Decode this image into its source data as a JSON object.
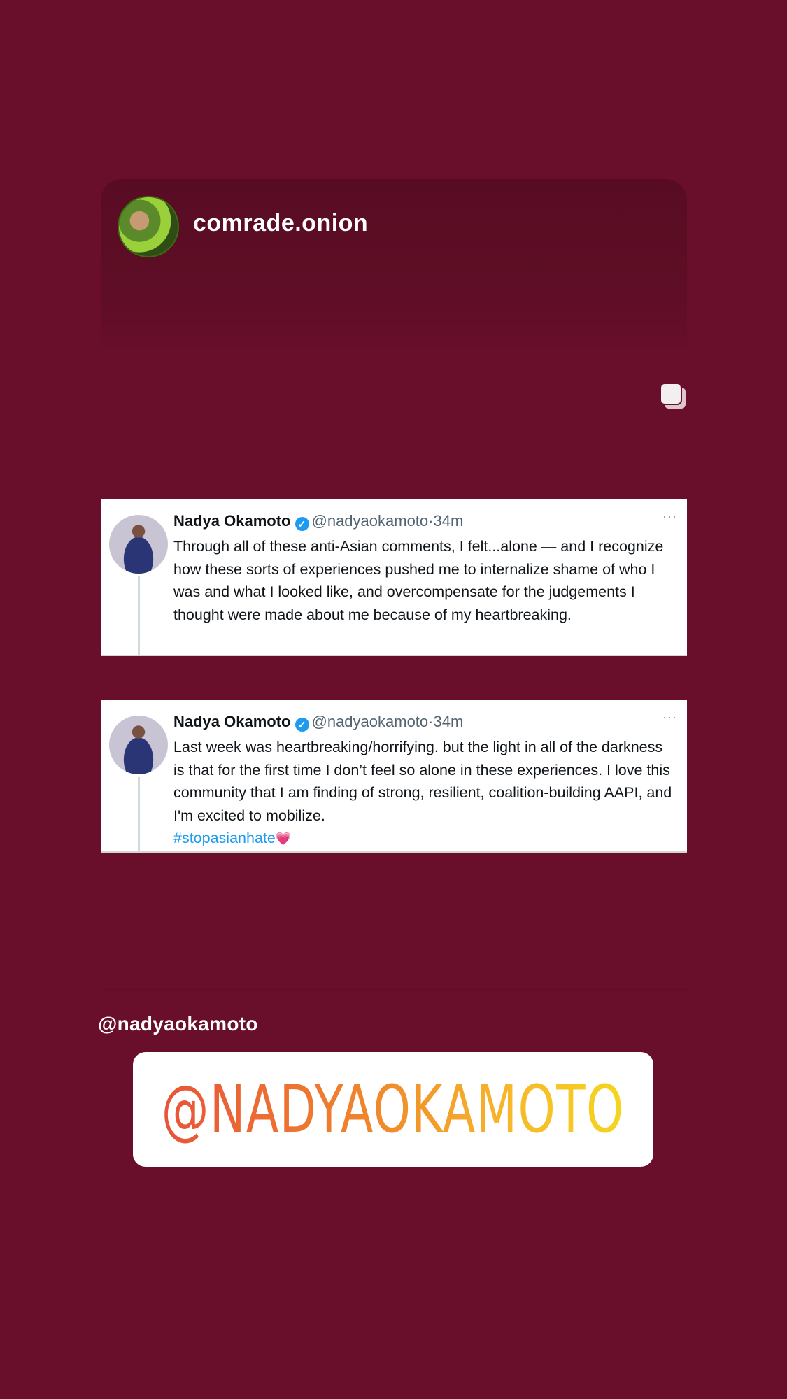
{
  "post": {
    "username": "comrade.onion",
    "avatar_icon": "profile-photo-icon"
  },
  "multi_post_icon": "carousel-icon",
  "tweets": [
    {
      "name": "Nadya Okamoto",
      "handle": "@nadyaokamoto",
      "time": "·34m",
      "more": "···",
      "verified": "✓",
      "text": "Through all of these anti-Asian comments, I felt...alone — and I recognize how these sorts of experiences pushed me to internalize shame of who I was and what I looked like, and overcompensate for the judgements I thought were made about me because of my heartbreaking."
    },
    {
      "name": "Nadya Okamoto",
      "handle": "@nadyaokamoto",
      "time": "·34m",
      "more": "···",
      "verified": "✓",
      "text": "Last week was heartbreaking/horrifying. but the light in all of the darkness is that for the first time I don’t feel so alone in these experiences. I love this community that I am finding of strong, resilient, coalition-building AAPI, and I'm excited to mobilize.",
      "hashtag": "#stopasianhate",
      "emoji": "💗"
    }
  ],
  "mention_label": "@nadyaokamoto",
  "mention_sticker": "@NADYAOKAMOTO",
  "colors": {
    "background": "#6a0f2b",
    "link": "#1d9bf0",
    "sticker_gradient_start": "#e8533a",
    "sticker_gradient_end": "#f5d61f"
  }
}
